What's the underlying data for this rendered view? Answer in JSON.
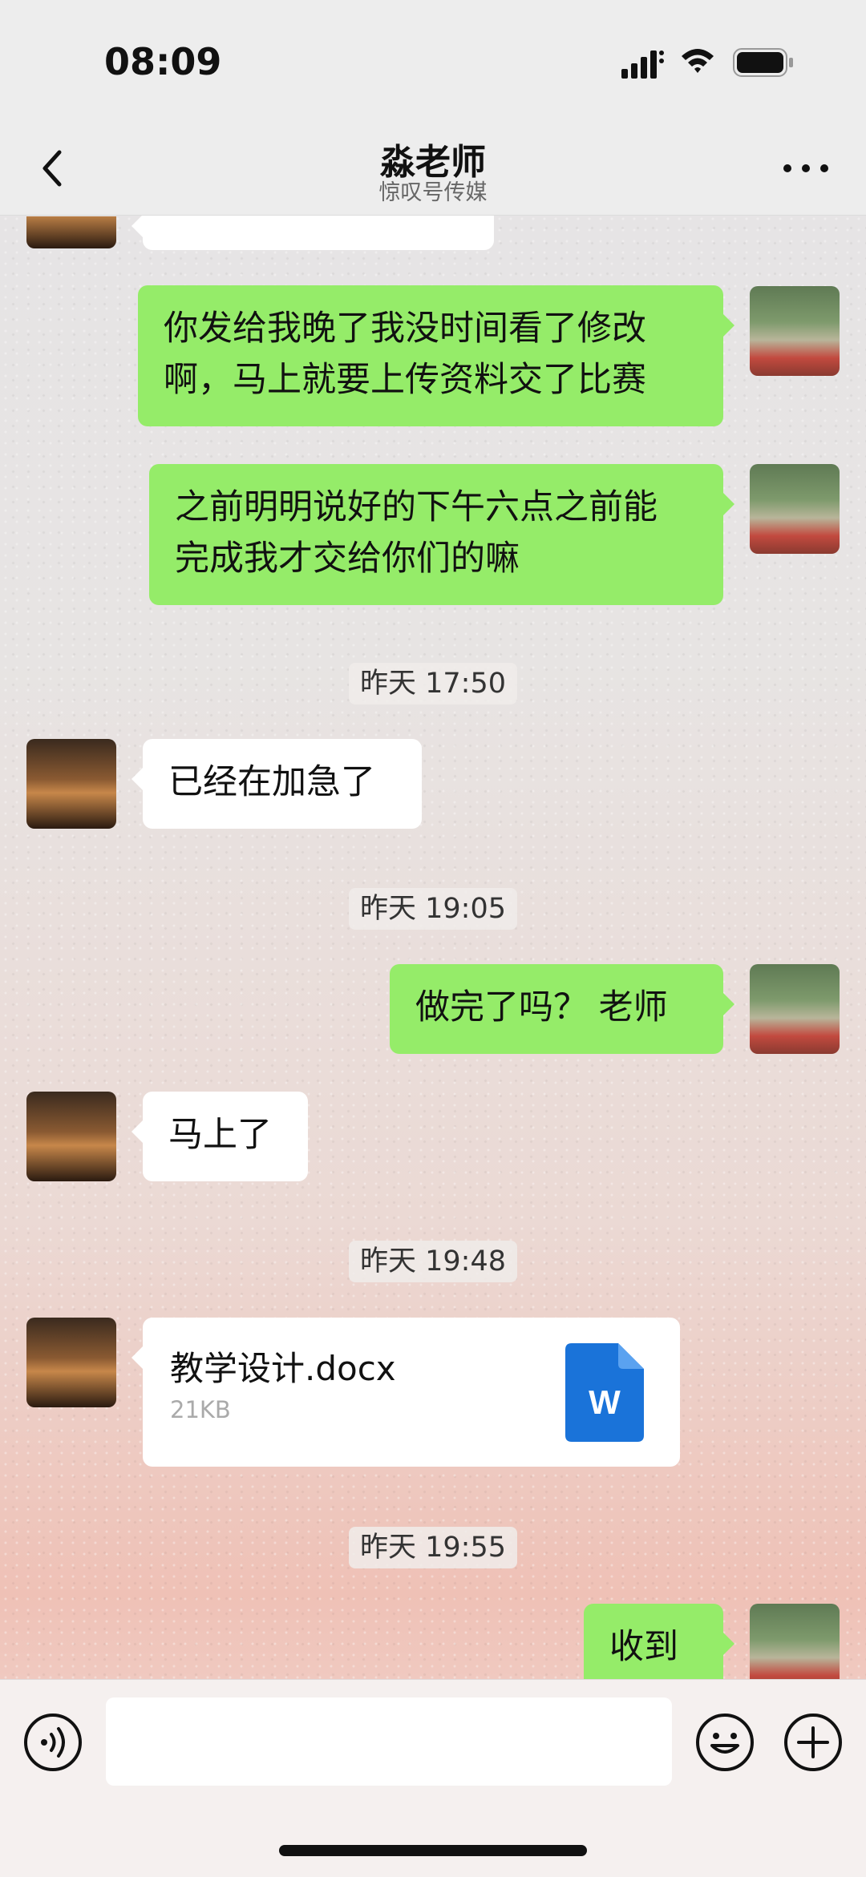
{
  "status": {
    "time": "08:09"
  },
  "header": {
    "title": "淼老师",
    "subtitle": "惊叹号传媒"
  },
  "messages": [
    {
      "text": "你发给我晚了我没时间看了修改",
      "text2": "啊，马上就要上传资料交了比赛"
    },
    {
      "text": "之前明明说好的下午六点之前能",
      "text2": "完成我才交给你们的嘛"
    },
    {
      "text": "已经在加急了"
    },
    {
      "text": "做完了吗？ 老师"
    },
    {
      "text": "马上了"
    },
    {
      "text": "收到"
    }
  ],
  "timestamps": [
    "昨天 17:50",
    "昨天 19:05",
    "昨天 19:48",
    "昨天 19:55"
  ],
  "file": {
    "name": "教学设计.docx",
    "size": "21KB",
    "icon_letter": "W"
  },
  "colors": {
    "outgoing_bubble": "#95ec69",
    "incoming_bubble": "#ffffff",
    "word_icon": "#1a73d9"
  }
}
